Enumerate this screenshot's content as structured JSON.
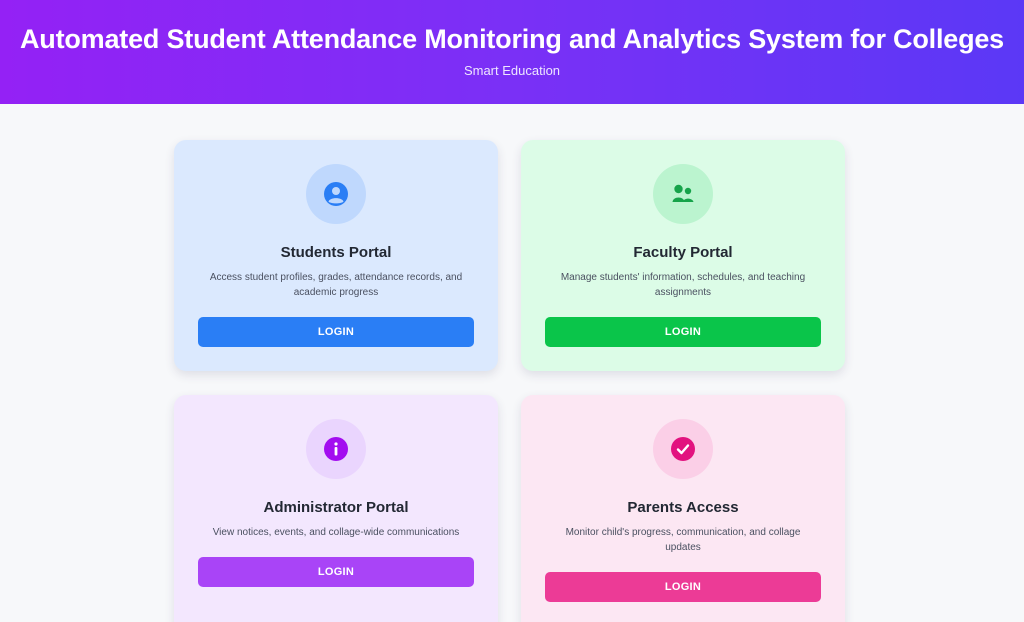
{
  "header": {
    "title": "Automated Student Attendance Monitoring and Analytics System for Colleges",
    "subtitle": "Smart Education"
  },
  "portals": [
    {
      "title": "Students Portal",
      "description": "Access student profiles, grades, attendance records, and academic progress",
      "button_label": "LOGIN",
      "icon": "user-circle-icon",
      "accent": "#2a7ef5"
    },
    {
      "title": "Faculty Portal",
      "description": "Manage students' information, schedules, and teaching assignments",
      "button_label": "LOGIN",
      "icon": "users-group-icon",
      "accent": "#0ac54a"
    },
    {
      "title": "Administrator Portal",
      "description": "View notices, events, and collage-wide communications",
      "button_label": "LOGIN",
      "icon": "info-circle-icon",
      "accent": "#a944f7"
    },
    {
      "title": "Parents Access",
      "description": "Monitor child's progress, communication, and collage updates",
      "button_label": "LOGIN",
      "icon": "check-circle-icon",
      "accent": "#ec3b96"
    }
  ]
}
